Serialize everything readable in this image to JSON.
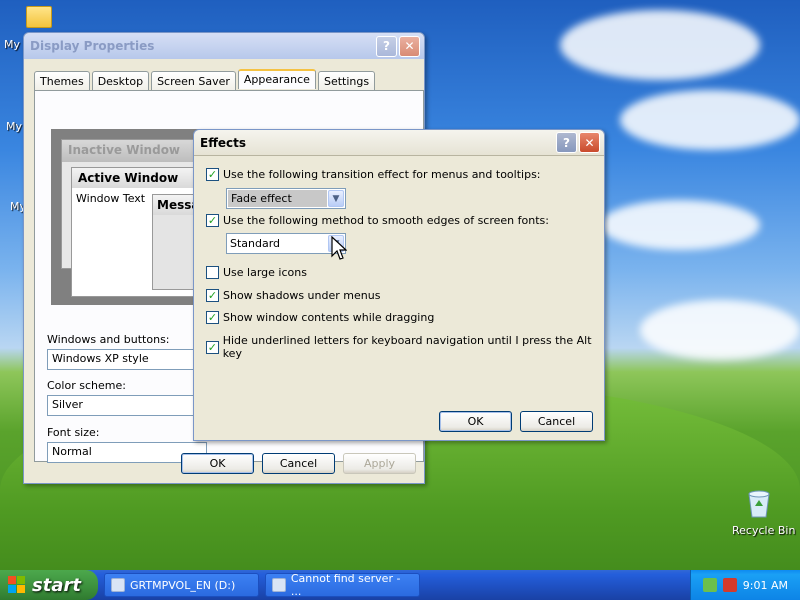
{
  "desktop": {
    "icons": [
      {
        "label": "My"
      },
      {
        "label": "My"
      },
      {
        "label": "My"
      },
      {
        "label": "Recycle Bin"
      }
    ]
  },
  "display_properties": {
    "title": "Display Properties",
    "tabs": [
      "Themes",
      "Desktop",
      "Screen Saver",
      "Appearance",
      "Settings"
    ],
    "selected_tab": "Appearance",
    "preview": {
      "inactive_title": "Inactive Window",
      "active_title": "Active Window",
      "window_text": "Window Text",
      "message_title": "Messag"
    },
    "windows_buttons_label": "Windows and buttons:",
    "windows_buttons_value": "Windows XP style",
    "color_scheme_label": "Color scheme:",
    "color_scheme_value": "Silver",
    "font_size_label": "Font size:",
    "font_size_value": "Normal",
    "ok_label": "OK",
    "cancel_label": "Cancel",
    "apply_label": "Apply"
  },
  "effects": {
    "title": "Effects",
    "options": [
      {
        "label": "Use the following transition effect for menus and tooltips:",
        "checked": true
      },
      {
        "label": "Use the following method to smooth edges of screen fonts:",
        "checked": true
      },
      {
        "label": "Use large icons",
        "checked": false
      },
      {
        "label": "Show shadows under menus",
        "checked": true
      },
      {
        "label": "Show window contents while dragging",
        "checked": true
      },
      {
        "label": "Hide underlined letters for keyboard navigation until I press the Alt key",
        "checked": true
      }
    ],
    "transition_value": "Fade effect",
    "smoothing_value": "Standard",
    "ok_label": "OK",
    "cancel_label": "Cancel"
  },
  "taskbar": {
    "start_label": "start",
    "tasks": [
      {
        "label": "GRTMPVOL_EN (D:)"
      },
      {
        "label": "Cannot find server - ..."
      }
    ],
    "clock": "9:01 AM"
  },
  "colors": {
    "xp_blue": "#245edb",
    "start_green": "#3c8f3c",
    "dialog_bg": "#ece9d8",
    "close_red": "#c94a2c"
  }
}
